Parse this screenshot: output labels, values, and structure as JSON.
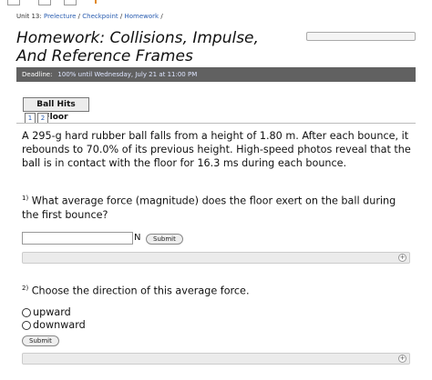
{
  "breadcrumb": {
    "unit": "Unit 13:",
    "items": [
      "Prelecture",
      "Checkpoint",
      "Homework"
    ],
    "separator": "/"
  },
  "title": "Homework: Collisions, Impulse, And Reference Frames",
  "deadline": {
    "label": "Deadline:",
    "value": "100% until Wednesday, July 21 at 11:00 PM"
  },
  "problem": {
    "title": "Ball Hits Floor",
    "parts": [
      "1",
      "2"
    ],
    "statement": "A 295-g hard rubber ball falls from a height of 1.80 m. After each bounce, it rebounds to 70.0% of its previous height. High-speed photos reveal that the ball is in contact with the floor for 16.3 ms during each bounce."
  },
  "question1": {
    "number": "1)",
    "text": "What average force (magnitude) does the floor exert on the ball during the first bounce?",
    "answer_value": "",
    "unit": "N",
    "submit_label": "Submit",
    "hint_symbol": "+"
  },
  "question2": {
    "number": "2)",
    "text": "Choose the direction of this average force.",
    "options": [
      "upward",
      "downward"
    ],
    "submit_label": "Submit",
    "hint_symbol": "+"
  },
  "colors": {
    "link": "#2a5db0",
    "deadline_bar": "#616161",
    "hint_bar": "#ebebeb"
  }
}
